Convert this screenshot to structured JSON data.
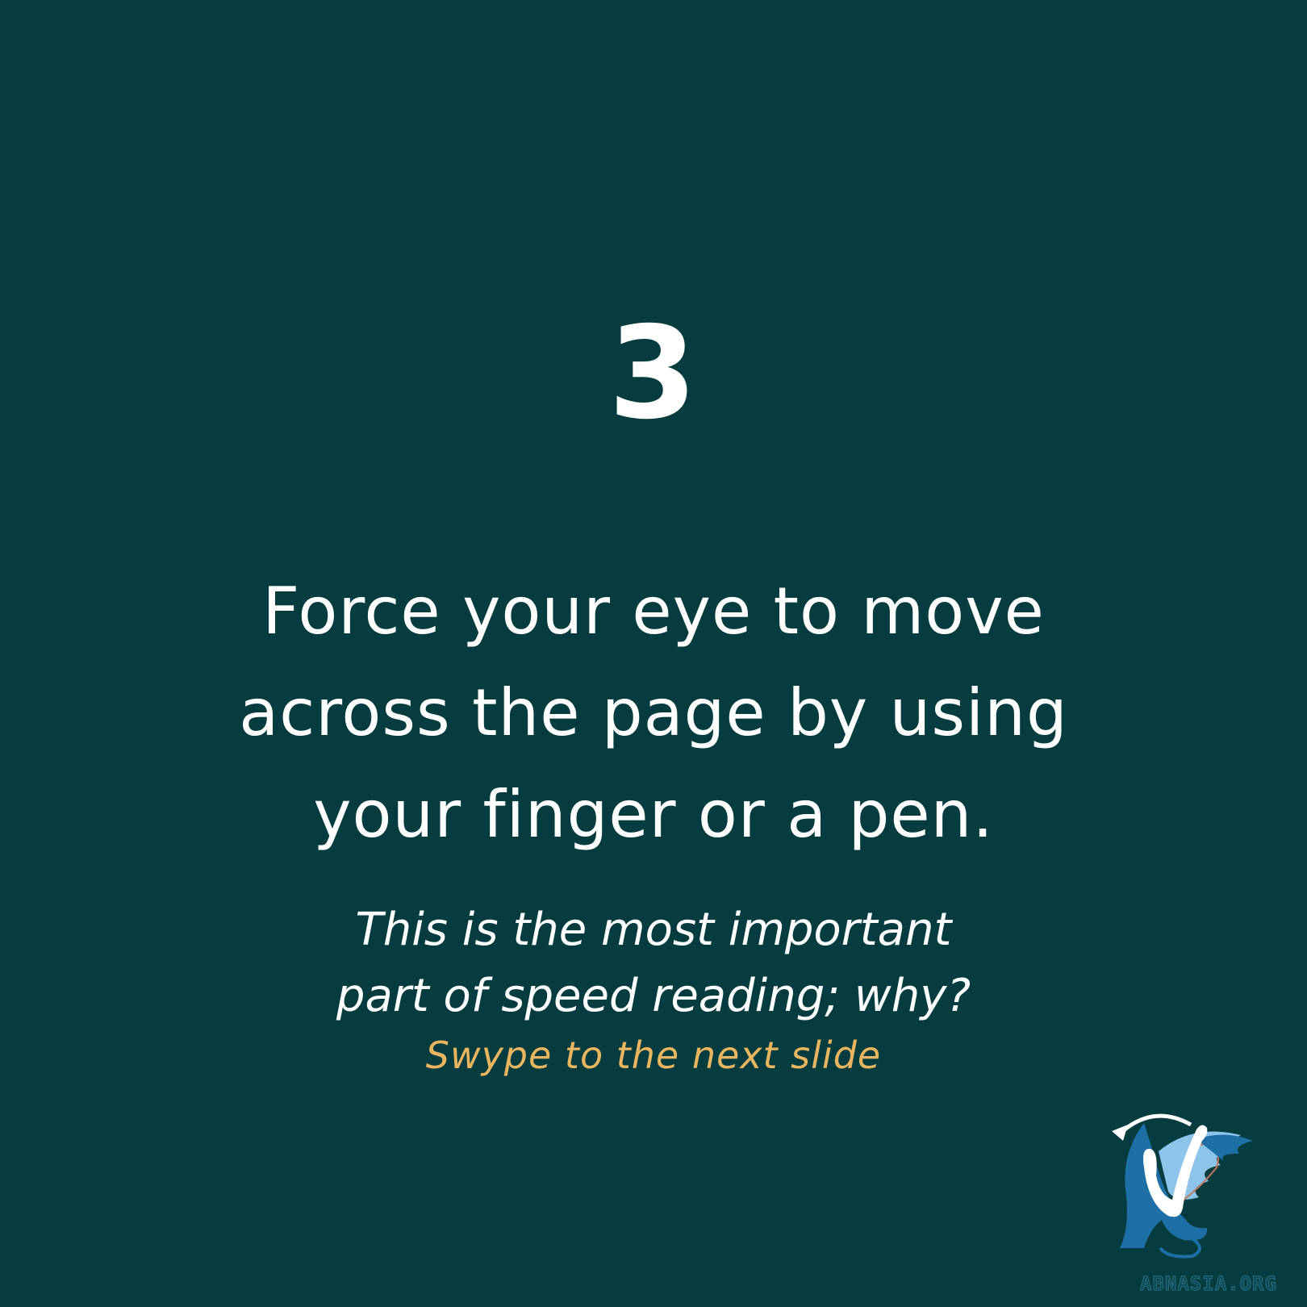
{
  "slide": {
    "step_number": "3",
    "headline_lines": [
      "Force your eye to move",
      "across the page by using",
      "your finger or a pen."
    ],
    "subtext_lines": [
      "This is the most important",
      "part of speed reading; why?"
    ],
    "call_to_action": "Swype to the next slide"
  },
  "logo": {
    "icon": "griffin-checkmark-logo",
    "text": "ABNASIA.ORG"
  },
  "colors": {
    "background": "#053c40",
    "text": "#ffffff",
    "accent": "#e9b55e",
    "logo_blue": "#1d6fa5",
    "logo_light_blue": "#8cc4ea"
  }
}
